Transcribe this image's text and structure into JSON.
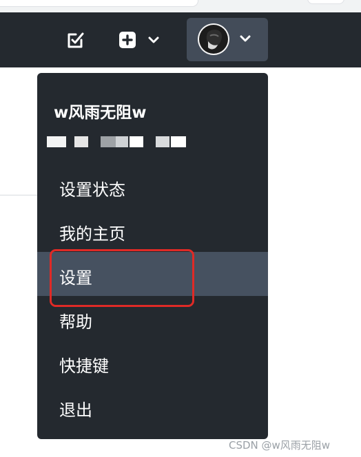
{
  "topbar": {
    "todo_icon": "checkbox-pencil-icon",
    "create_icon": "plus-square-icon",
    "profile_icon": "avatar-photo",
    "caret_icon": "chevron-down-icon"
  },
  "menu": {
    "user_name": "w风雨无阻w",
    "items": [
      {
        "label": "设置状态"
      },
      {
        "label": "我的主页"
      },
      {
        "label": "设置"
      },
      {
        "label": "帮助"
      },
      {
        "label": "快捷键"
      },
      {
        "label": "退出"
      }
    ],
    "active_index": 2
  },
  "watermark": "CSDN @w风雨无阻w",
  "colors": {
    "topbar": "#24292f",
    "menu_bg": "#24292f",
    "active_item": "#465160",
    "highlight": "#e02a26"
  }
}
